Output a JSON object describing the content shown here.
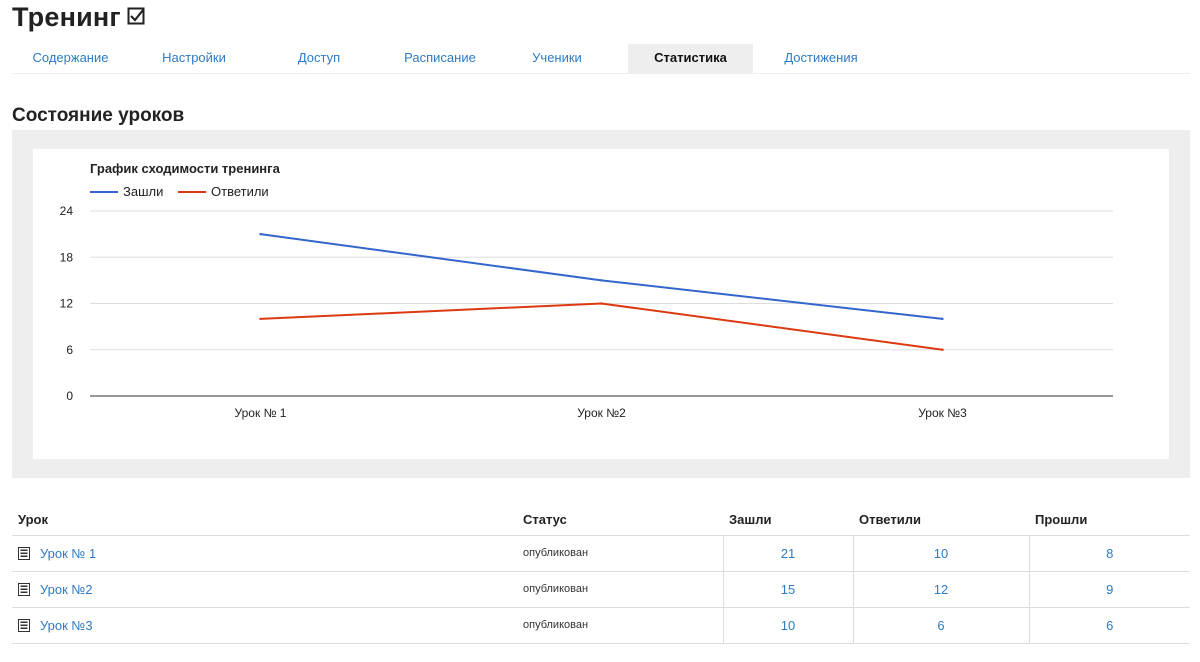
{
  "page": {
    "title": "Тренинг"
  },
  "tabs": [
    {
      "label": "Содержание",
      "active": false
    },
    {
      "label": "Настройки",
      "active": false
    },
    {
      "label": "Доступ",
      "active": false
    },
    {
      "label": "Расписание",
      "active": false
    },
    {
      "label": "Ученики",
      "active": false
    },
    {
      "label": "Статистика",
      "active": true
    },
    {
      "label": "Достижения",
      "active": false
    }
  ],
  "section": {
    "title": "Состояние уроков"
  },
  "chart_data": {
    "type": "line",
    "title": "График сходимости тренинга",
    "categories": [
      "Урок № 1",
      "Урок №2",
      "Урок №3"
    ],
    "series": [
      {
        "name": "Зашли",
        "values": [
          21,
          15,
          10
        ],
        "color": "#3366cc"
      },
      {
        "name": "Ответили",
        "values": [
          10,
          12,
          6
        ],
        "color": "#dc3912"
      }
    ],
    "yticks": [
      0,
      6,
      12,
      18,
      24
    ],
    "ylim": [
      0,
      24
    ],
    "grid": true,
    "legend": "top-left"
  },
  "table": {
    "headers": {
      "lesson": "Урок",
      "status": "Статус",
      "entered": "Зашли",
      "answered": "Ответили",
      "passed": "Прошли"
    },
    "rows": [
      {
        "lesson": "Урок № 1",
        "status": "опубликован",
        "entered": "21",
        "answered": "10",
        "passed": "8"
      },
      {
        "lesson": "Урок №2",
        "status": "опубликован",
        "entered": "15",
        "answered": "12",
        "passed": "9"
      },
      {
        "lesson": "Урок №3",
        "status": "опубликован",
        "entered": "10",
        "answered": "6",
        "passed": "6"
      }
    ]
  },
  "icons": {
    "title_icon": "checkbox-checked-icon",
    "lesson_icon": "document-list-icon"
  },
  "colors": {
    "link": "#2d7bc4",
    "panel_bg": "#eeeeee",
    "active_tab_bg": "#eeeeee"
  }
}
